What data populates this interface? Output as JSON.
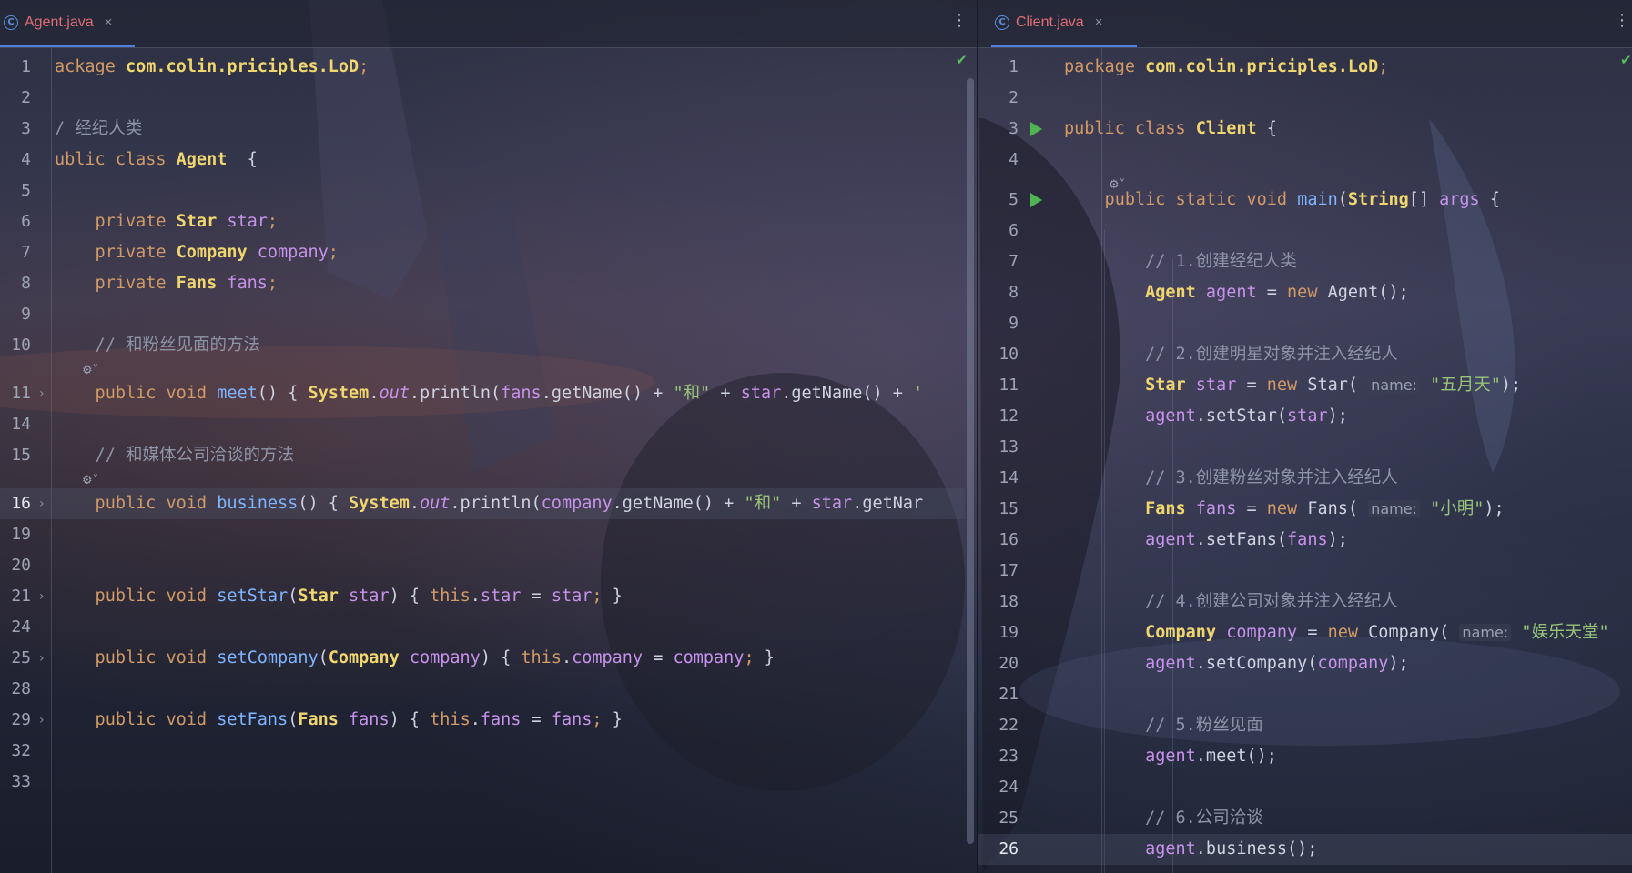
{
  "left_editor": {
    "tab": {
      "icon": "class-c-icon",
      "label": "Agent.java",
      "close": "×",
      "menu": "⋮"
    },
    "lines": [
      {
        "n": "1",
        "tokens": [
          [
            "kw",
            "ackage "
          ],
          [
            "ty",
            "com.colin.priciples.LoD"
          ],
          [
            "kw",
            ";"
          ]
        ]
      },
      {
        "n": "2",
        "tokens": []
      },
      {
        "n": "3",
        "tokens": [
          [
            "cmt",
            "/ 经纪人类"
          ]
        ]
      },
      {
        "n": "4",
        "tokens": [
          [
            "kw",
            "ublic class "
          ],
          [
            "ty",
            "Agent"
          ],
          [
            "",
            "  {"
          ]
        ]
      },
      {
        "n": "5",
        "tokens": []
      },
      {
        "n": "6",
        "tokens": [
          [
            "kw",
            "    private "
          ],
          [
            "ty",
            "Star"
          ],
          [
            "fld",
            " star"
          ],
          [
            "kw",
            ";"
          ]
        ]
      },
      {
        "n": "7",
        "tokens": [
          [
            "kw",
            "    private "
          ],
          [
            "ty",
            "Company"
          ],
          [
            "fld",
            " company"
          ],
          [
            "kw",
            ";"
          ]
        ]
      },
      {
        "n": "8",
        "tokens": [
          [
            "kw",
            "    private "
          ],
          [
            "ty",
            "Fans"
          ],
          [
            "fld",
            " fans"
          ],
          [
            "kw",
            ";"
          ]
        ]
      },
      {
        "n": "9",
        "tokens": []
      },
      {
        "n": "10",
        "tokens": [
          [
            "cmt",
            "    // 和粉丝见面的方法"
          ]
        ]
      },
      {
        "n": "11",
        "fold": true,
        "tokens": [
          [
            "kw",
            "    public void "
          ],
          [
            "fn",
            "meet"
          ],
          [
            "",
            "() { "
          ],
          [
            "ty",
            "System"
          ],
          [
            "",
            "."
          ],
          [
            "it",
            "out"
          ],
          [
            "",
            ".println("
          ],
          [
            "fld",
            "fans"
          ],
          [
            "",
            ".getName() + "
          ],
          [
            "str",
            "\"和\""
          ],
          [
            "",
            " + "
          ],
          [
            "fld",
            "star"
          ],
          [
            "",
            ".getName() + "
          ],
          [
            "str",
            "'"
          ]
        ]
      },
      {
        "n": "14",
        "tokens": []
      },
      {
        "n": "15",
        "tokens": [
          [
            "cmt",
            "    // 和媒体公司洽谈的方法"
          ]
        ]
      },
      {
        "n": "16",
        "fold": true,
        "current": true,
        "tokens": [
          [
            "kw",
            "    public void "
          ],
          [
            "fn",
            "business"
          ],
          [
            "",
            "() { "
          ],
          [
            "ty",
            "System"
          ],
          [
            "",
            "."
          ],
          [
            "it",
            "out"
          ],
          [
            "",
            ".println("
          ],
          [
            "fld",
            "company"
          ],
          [
            "",
            ".getName() + "
          ],
          [
            "str",
            "\"和\""
          ],
          [
            "",
            " + "
          ],
          [
            "fld",
            "star"
          ],
          [
            "",
            ".getNar"
          ]
        ]
      },
      {
        "n": "19",
        "tokens": []
      },
      {
        "n": "20",
        "tokens": []
      },
      {
        "n": "21",
        "fold": true,
        "tokens": [
          [
            "kw",
            "    public void "
          ],
          [
            "fn",
            "setStar"
          ],
          [
            "",
            "("
          ],
          [
            "ty",
            "Star"
          ],
          [
            "fld",
            " star"
          ],
          [
            "",
            ") { "
          ],
          [
            "kw",
            "this"
          ],
          [
            "",
            "."
          ],
          [
            "fld",
            "star"
          ],
          [
            "",
            " = "
          ],
          [
            "fld",
            "star"
          ],
          [
            "kw",
            ";"
          ],
          [
            "",
            " }"
          ]
        ]
      },
      {
        "n": "24",
        "tokens": []
      },
      {
        "n": "25",
        "fold": true,
        "tokens": [
          [
            "kw",
            "    public void "
          ],
          [
            "fn",
            "setCompany"
          ],
          [
            "",
            "("
          ],
          [
            "ty",
            "Company"
          ],
          [
            "fld",
            " company"
          ],
          [
            "",
            ") { "
          ],
          [
            "kw",
            "this"
          ],
          [
            "",
            "."
          ],
          [
            "fld",
            "company"
          ],
          [
            "",
            " = "
          ],
          [
            "fld",
            "company"
          ],
          [
            "kw",
            ";"
          ],
          [
            "",
            " }"
          ]
        ]
      },
      {
        "n": "28",
        "tokens": []
      },
      {
        "n": "29",
        "fold": true,
        "tokens": [
          [
            "kw",
            "    public void "
          ],
          [
            "fn",
            "setFans"
          ],
          [
            "",
            "("
          ],
          [
            "ty",
            "Fans"
          ],
          [
            "fld",
            " fans"
          ],
          [
            "",
            ") { "
          ],
          [
            "kw",
            "this"
          ],
          [
            "",
            "."
          ],
          [
            "fld",
            "fans"
          ],
          [
            "",
            " = "
          ],
          [
            "fld",
            "fans"
          ],
          [
            "kw",
            ";"
          ],
          [
            "",
            " }"
          ]
        ]
      },
      {
        "n": "32",
        "tokens": []
      },
      {
        "n": "33",
        "tokens": []
      }
    ]
  },
  "right_editor": {
    "tab": {
      "icon": "class-c-icon",
      "label": "Client.java",
      "close": "×",
      "menu": "⋮"
    },
    "lines": [
      {
        "n": "1",
        "tokens": [
          [
            "kw",
            "package "
          ],
          [
            "ty",
            "com.colin.priciples.LoD"
          ],
          [
            "kw",
            ";"
          ]
        ]
      },
      {
        "n": "2",
        "tokens": []
      },
      {
        "n": "3",
        "run": true,
        "tokens": [
          [
            "kw",
            "public class "
          ],
          [
            "ty",
            "Client"
          ],
          [
            "",
            " {"
          ]
        ]
      },
      {
        "n": "4",
        "tokens": []
      },
      {
        "n": "5",
        "run": true,
        "tokens": [
          [
            "kw",
            "    public static void "
          ],
          [
            "fn",
            "main"
          ],
          [
            "",
            "("
          ],
          [
            "ty",
            "String"
          ],
          [
            "",
            "[] "
          ],
          [
            "fld",
            "args"
          ],
          [
            "",
            " {"
          ]
        ]
      },
      {
        "n": "6",
        "tokens": []
      },
      {
        "n": "7",
        "tokens": [
          [
            "cmt",
            "        // 1.创建经纪人类"
          ]
        ]
      },
      {
        "n": "8",
        "tokens": [
          [
            "ty",
            "        Agent"
          ],
          [
            "fld",
            " agent"
          ],
          [
            "",
            " = "
          ],
          [
            "kw",
            "new "
          ],
          [
            "",
            "Agent();"
          ]
        ]
      },
      {
        "n": "9",
        "tokens": []
      },
      {
        "n": "10",
        "tokens": [
          [
            "cmt",
            "        // 2.创建明星对象并注入经纪人"
          ]
        ]
      },
      {
        "n": "11",
        "tokens": [
          [
            "ty",
            "        Star"
          ],
          [
            "fld",
            " star"
          ],
          [
            "",
            " = "
          ],
          [
            "kw",
            "new "
          ],
          [
            "",
            "Star( "
          ],
          [
            "hint",
            "name:"
          ],
          [
            "str",
            " \"五月天\""
          ],
          [
            "",
            ");"
          ]
        ]
      },
      {
        "n": "12",
        "tokens": [
          [
            "fld",
            "        agent"
          ],
          [
            "",
            ".setStar("
          ],
          [
            "fld",
            "star"
          ],
          [
            "",
            ");"
          ]
        ]
      },
      {
        "n": "13",
        "tokens": []
      },
      {
        "n": "14",
        "tokens": [
          [
            "cmt",
            "        // 3.创建粉丝对象并注入经纪人"
          ]
        ]
      },
      {
        "n": "15",
        "tokens": [
          [
            "ty",
            "        Fans"
          ],
          [
            "fld",
            " fans"
          ],
          [
            "",
            " = "
          ],
          [
            "kw",
            "new "
          ],
          [
            "",
            "Fans( "
          ],
          [
            "hint",
            "name:"
          ],
          [
            "str",
            " \"小明\""
          ],
          [
            "",
            ");"
          ]
        ]
      },
      {
        "n": "16",
        "tokens": [
          [
            "fld",
            "        agent"
          ],
          [
            "",
            ".setFans("
          ],
          [
            "fld",
            "fans"
          ],
          [
            "",
            ");"
          ]
        ]
      },
      {
        "n": "17",
        "tokens": []
      },
      {
        "n": "18",
        "tokens": [
          [
            "cmt",
            "        // 4.创建公司对象并注入经纪人"
          ]
        ]
      },
      {
        "n": "19",
        "tokens": [
          [
            "ty",
            "        Company"
          ],
          [
            "fld",
            " company"
          ],
          [
            "",
            " = "
          ],
          [
            "kw",
            "new "
          ],
          [
            "",
            "Company( "
          ],
          [
            "hint",
            "name:"
          ],
          [
            "str",
            " \"娱乐天堂\""
          ]
        ]
      },
      {
        "n": "20",
        "tokens": [
          [
            "fld",
            "        agent"
          ],
          [
            "",
            ".setCompany("
          ],
          [
            "fld",
            "company"
          ],
          [
            "",
            ");"
          ]
        ]
      },
      {
        "n": "21",
        "tokens": []
      },
      {
        "n": "22",
        "tokens": [
          [
            "cmt",
            "        // 5.粉丝见面"
          ]
        ]
      },
      {
        "n": "23",
        "tokens": [
          [
            "fld",
            "        agent"
          ],
          [
            "",
            ".meet();"
          ]
        ]
      },
      {
        "n": "24",
        "tokens": []
      },
      {
        "n": "25",
        "tokens": [
          [
            "cmt",
            "        // 6.公司洽谈"
          ]
        ]
      },
      {
        "n": "26",
        "current": true,
        "tokens": [
          [
            "fld",
            "        agent"
          ],
          [
            "",
            ".business();"
          ]
        ]
      }
    ]
  },
  "icons": {
    "run": "run-gutter-icon",
    "fold": "fold-arrow-icon",
    "check": "inspection-ok-icon"
  },
  "colors": {
    "keyword": "#d19a66",
    "type": "#f0d66e",
    "method": "#7fb4ff",
    "field": "#c792ea",
    "string": "#98c379",
    "comment": "#8e94a8",
    "tab_accent": "#4f7fd9",
    "tab_label": "#e06c75",
    "run": "#4fb552"
  }
}
